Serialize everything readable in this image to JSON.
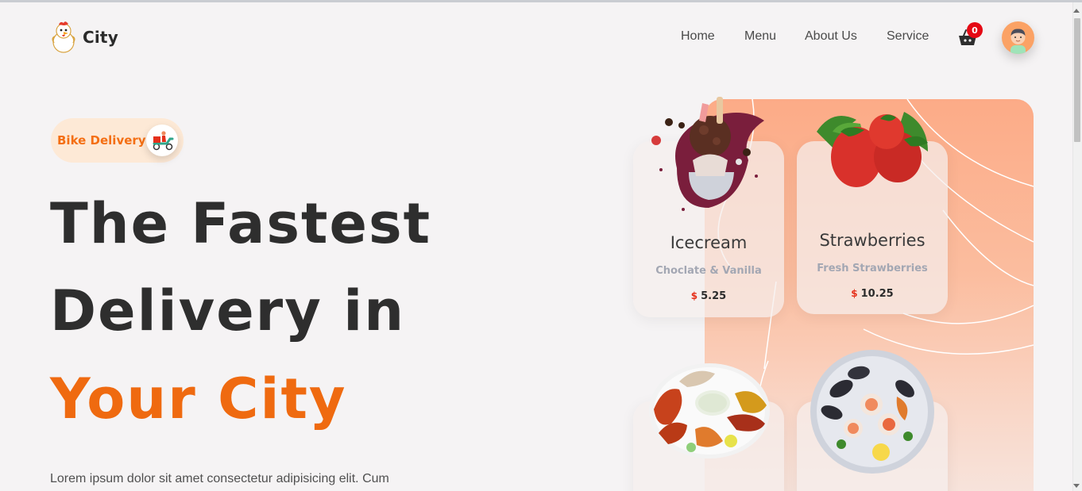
{
  "brand": {
    "name": "City",
    "logo_icon": "chicken-mascot-icon"
  },
  "nav": {
    "items": [
      "Home",
      "Menu",
      "About Us",
      "Service"
    ],
    "cart_count": "0",
    "cart_icon": "shopping-basket-icon",
    "avatar_icon": "user-avatar-icon"
  },
  "hero": {
    "badge_label": "Bike Delivery",
    "badge_icon": "scooter-delivery-icon",
    "headline_line1": "The Fastest",
    "headline_line2": "Delivery in",
    "headline_line3": "Your City",
    "description": "Lorem ipsum dolor sit amet consectetur adipisicing elit. Cum"
  },
  "products": [
    {
      "title": "Icecream",
      "subtitle": "Choclate & Vanilla",
      "currency": "$",
      "price": "5.25"
    },
    {
      "title": "Strawberries",
      "subtitle": "Fresh Strawberries",
      "currency": "$",
      "price": "10.25"
    },
    {
      "title": "",
      "subtitle": "",
      "currency": "",
      "price": ""
    },
    {
      "title": "",
      "subtitle": "",
      "currency": "",
      "price": ""
    }
  ],
  "colors": {
    "accent": "#ef6a10",
    "badge_bg": "#fde9d6",
    "cart_badge": "#e50914",
    "panel_top": "#fcab87",
    "background": "#f5f3f4"
  }
}
